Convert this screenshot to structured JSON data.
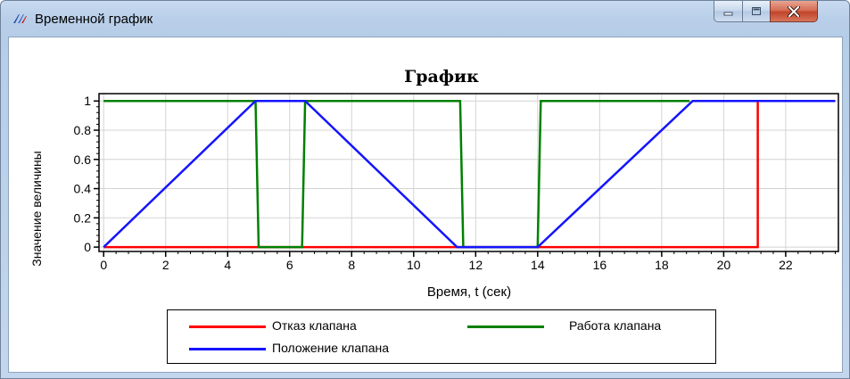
{
  "window": {
    "title": "Временной график",
    "controls": [
      "minimize",
      "maximize",
      "close"
    ]
  },
  "colors": {
    "series_red": "#ff0000",
    "series_green": "#008000",
    "series_blue": "#1414ff",
    "titlebar": "#b9cfe9"
  },
  "chart_data": {
    "type": "line",
    "title": "График",
    "xlabel": "Время, t (сек)",
    "ylabel": "Значение величины",
    "xlim": [
      -0.15,
      23.7
    ],
    "ylim": [
      -0.03,
      1.05
    ],
    "xticks": [
      0,
      2,
      4,
      6,
      8,
      10,
      12,
      14,
      16,
      18,
      20,
      22
    ],
    "yticks": [
      0,
      0.2,
      0.4,
      0.6,
      0.8,
      1
    ],
    "ytick_labels": [
      "0",
      "0.2",
      "0.4",
      "0.6",
      "0.8",
      "1"
    ],
    "grid": true,
    "legend_position": "bottom",
    "series": [
      {
        "name": "Отказ клапана",
        "color": "#ff0000",
        "points": [
          [
            0,
            0
          ],
          [
            21.1,
            0
          ],
          [
            21.1,
            1
          ]
        ]
      },
      {
        "name": "Работа клапана",
        "color": "#008000",
        "points": [
          [
            0,
            1
          ],
          [
            4.9,
            1
          ],
          [
            5.0,
            0
          ],
          [
            6.4,
            0
          ],
          [
            6.5,
            1
          ],
          [
            11.5,
            1
          ],
          [
            11.6,
            0
          ],
          [
            14.0,
            0
          ],
          [
            14.1,
            1
          ],
          [
            18.9,
            1
          ]
        ]
      },
      {
        "name": "Положение клапана",
        "color": "#1414ff",
        "points": [
          [
            0,
            0
          ],
          [
            4.9,
            1
          ],
          [
            6.5,
            1
          ],
          [
            11.4,
            0
          ],
          [
            14.0,
            0
          ],
          [
            19.0,
            1
          ],
          [
            23.6,
            1
          ]
        ]
      }
    ]
  }
}
